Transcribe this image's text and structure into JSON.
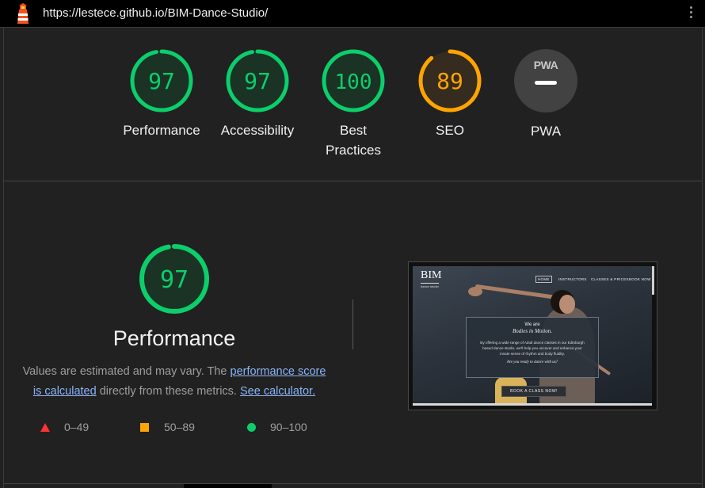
{
  "browser": {
    "url": "https://lestece.github.io/BIM-Dance-Studio/",
    "logo_icon": "lighthouse-icon",
    "menu_icon": "kebab-menu-icon"
  },
  "colors": {
    "pass": "#0cce6b",
    "average": "#ffa400",
    "fail": "#ff3333",
    "pass_fill": "#1b3325",
    "average_fill": "#352b1f"
  },
  "gauges": [
    {
      "label": "Performance",
      "score": 97,
      "rating": "pass"
    },
    {
      "label": "Accessibility",
      "score": 97,
      "rating": "pass"
    },
    {
      "label": "Best Practices",
      "label_line1": "Best",
      "label_line2": "Practices",
      "score": 100,
      "rating": "pass"
    },
    {
      "label": "SEO",
      "score": 89,
      "rating": "average"
    }
  ],
  "pwa": {
    "badge_text": "PWA",
    "label": "PWA"
  },
  "performance": {
    "score": 97,
    "title": "Performance",
    "desc_1": "Values are estimated and may vary. The ",
    "link_score": "performance score",
    "desc_2": "is calculated",
    "desc_3": " directly from these metrics. ",
    "link_calculator": "See calculator."
  },
  "legend": [
    {
      "shape": "triangle",
      "range": "0–49"
    },
    {
      "shape": "square",
      "range": "50–89"
    },
    {
      "shape": "circle",
      "range": "90–100"
    }
  ],
  "preview": {
    "brand": "BIM",
    "brand_sub": "dance studio",
    "nav": [
      "HOME",
      "INSTRUCTORS",
      "CLASSES & PRICES",
      "BOOK NOW"
    ],
    "hero_we": "We are",
    "hero_title": "Bodies in Motion.",
    "hero_body": "By offering a wide range of Adult dance classes in our Edinburgh based dance studio, we'll help you uncover and enhance your innate sense of rhythm and body fluidity.",
    "hero_question": "Are you ready to dance with us?",
    "cta": "BOOK A CLASS NOW!"
  }
}
